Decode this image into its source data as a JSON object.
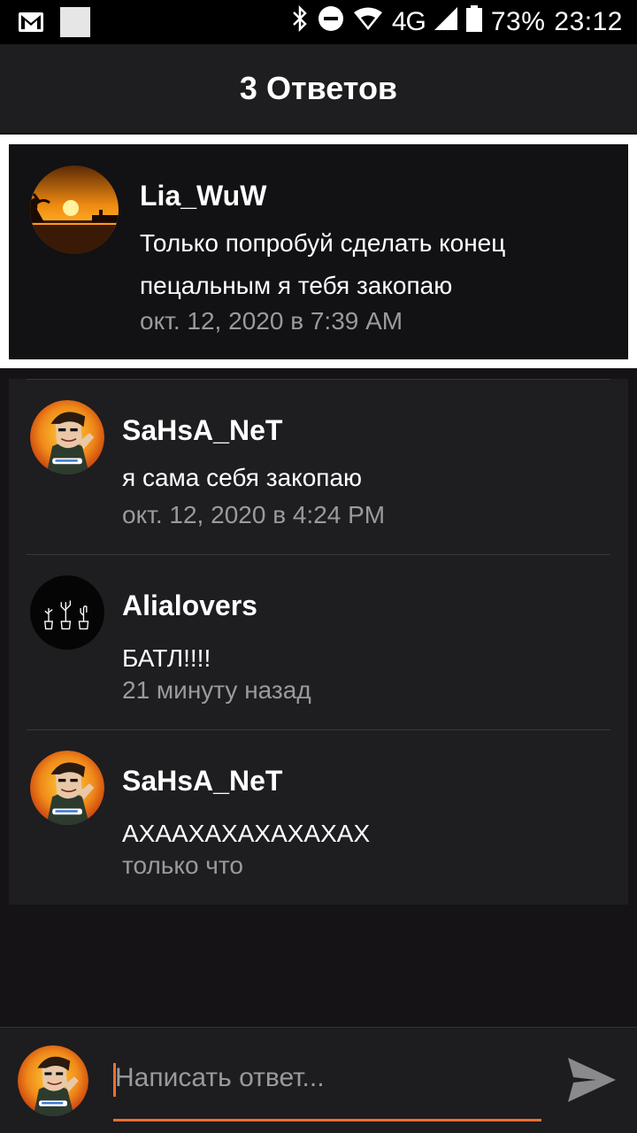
{
  "status_bar": {
    "network": "4G",
    "battery_percent": "73%",
    "time": "23:12",
    "icons": [
      "gmail-icon",
      "notification-square-icon",
      "bluetooth-icon",
      "do-not-disturb-icon",
      "wifi-icon",
      "signal-icon",
      "battery-icon"
    ]
  },
  "header": {
    "title": "3 Ответов"
  },
  "original_post": {
    "author": "Lia_WuW",
    "text_line1": "Только попробуй сделать конец",
    "text_line2": "пецальным я тебя закопаю",
    "timestamp": "окт. 12, 2020 в 7:39 AM"
  },
  "replies": [
    {
      "author": "SaHsA_NeT",
      "text": "я сама себя закопаю",
      "timestamp": "окт. 12, 2020 в 4:24 PM",
      "avatar": "anime-avatar"
    },
    {
      "author": "Alialovers",
      "text": "БАТЛ!!!!",
      "timestamp": "21 минуту назад",
      "avatar": "cactus-avatar"
    },
    {
      "author": "SaHsA_NeT",
      "text": "АХААХАХАХАХАХАХ",
      "timestamp": "только что",
      "avatar": "anime-avatar"
    }
  ],
  "composer": {
    "placeholder": "Написать ответ...",
    "accent_color": "#f26d2e",
    "send_icon": "send-icon"
  }
}
